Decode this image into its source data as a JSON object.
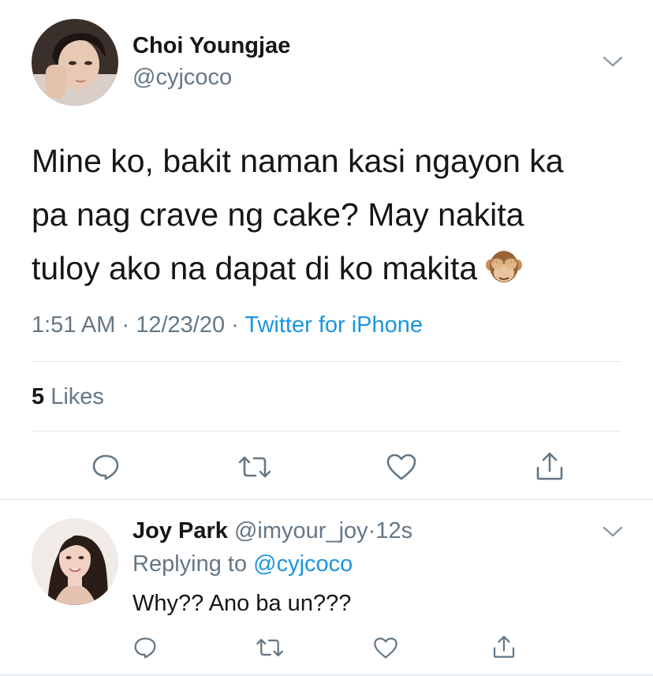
{
  "main_tweet": {
    "display_name": "Choi Youngjae",
    "handle": "@cyjcoco",
    "text_lines": [
      "Mine ko, bakit naman kasi ngayon ka",
      "pa nag crave ng cake? May nakita",
      "tuloy ako na dapat di ko makita"
    ],
    "emoji_icon": "see-no-evil-monkey-emoji",
    "time": "1:51 AM",
    "separator": "·",
    "date": "12/23/20",
    "source": "Twitter for iPhone",
    "likes_count": "5",
    "likes_label": "Likes",
    "actions": [
      "reply-icon",
      "retweet-icon",
      "like-icon",
      "share-icon"
    ]
  },
  "reply_tweet": {
    "display_name": "Joy Park",
    "handle": "@imyour_joy",
    "separator": "·",
    "time": "12s",
    "replying_label": "Replying to",
    "replying_to": "@cyjcoco",
    "text": "Why?? Ano ba un???",
    "actions": [
      "reply-icon",
      "retweet-icon",
      "like-icon",
      "share-icon"
    ]
  },
  "colors": {
    "text_primary": "#14171a",
    "text_secondary": "#657786",
    "link": "#1b95e0",
    "icon": "#657786",
    "divider": "#e1e8ed"
  }
}
